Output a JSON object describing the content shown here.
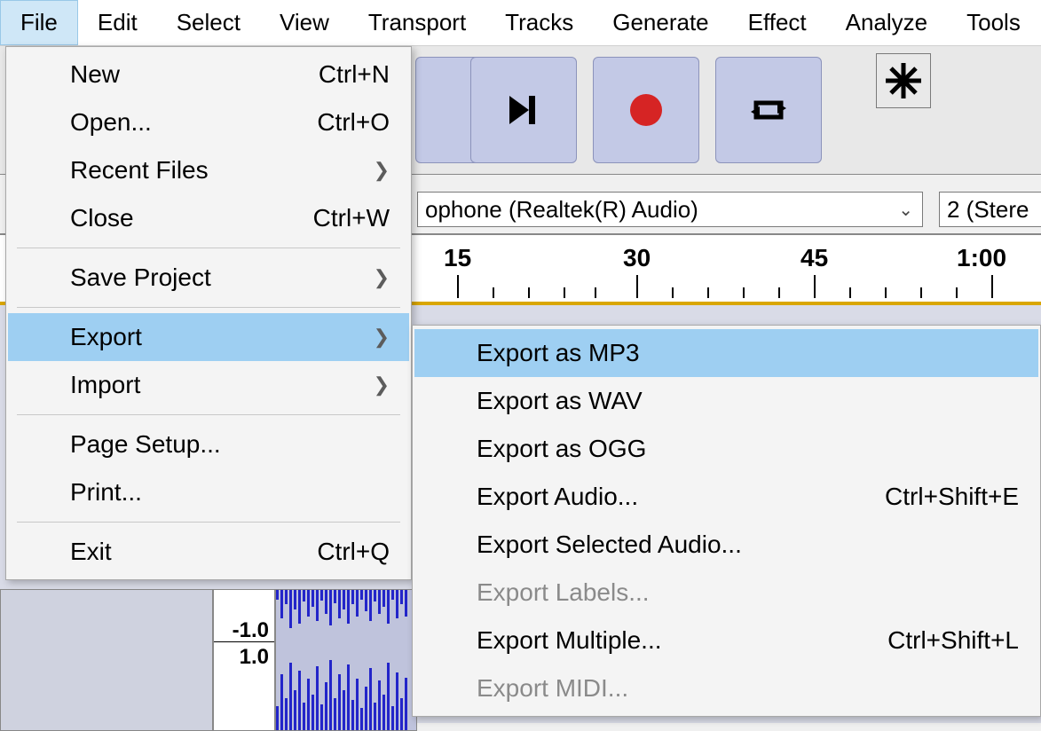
{
  "menubar": {
    "items": [
      "File",
      "Edit",
      "Select",
      "View",
      "Transport",
      "Tracks",
      "Generate",
      "Effect",
      "Analyze",
      "Tools"
    ],
    "active_index": 0
  },
  "device": {
    "input_visible": "ophone (Realtek(R) Audio)",
    "channels_visible": "2 (Stere"
  },
  "timeline": {
    "labels": [
      "15",
      "30",
      "45",
      "1:00"
    ]
  },
  "vruler": {
    "top": "-1.0",
    "bottom": "1.0"
  },
  "file_menu": [
    {
      "label": "New",
      "shortcut": "Ctrl+N"
    },
    {
      "label": "Open...",
      "shortcut": "Ctrl+O"
    },
    {
      "label": "Recent Files",
      "submenu": true
    },
    {
      "label": "Close",
      "shortcut": "Ctrl+W"
    },
    {
      "sep": true
    },
    {
      "label": "Save Project",
      "submenu": true
    },
    {
      "sep": true
    },
    {
      "label": "Export",
      "submenu": true,
      "highlight": true
    },
    {
      "label": "Import",
      "submenu": true
    },
    {
      "sep": true
    },
    {
      "label": "Page Setup..."
    },
    {
      "label": "Print..."
    },
    {
      "sep": true
    },
    {
      "label": "Exit",
      "shortcut": "Ctrl+Q"
    }
  ],
  "export_menu": [
    {
      "label": "Export as MP3",
      "highlight": true
    },
    {
      "label": "Export as WAV"
    },
    {
      "label": "Export as OGG"
    },
    {
      "label": "Export Audio...",
      "shortcut": "Ctrl+Shift+E"
    },
    {
      "label": "Export Selected Audio..."
    },
    {
      "label": "Export Labels...",
      "disabled": true
    },
    {
      "label": "Export Multiple...",
      "shortcut": "Ctrl+Shift+L"
    },
    {
      "label": "Export MIDI...",
      "disabled": true
    }
  ]
}
